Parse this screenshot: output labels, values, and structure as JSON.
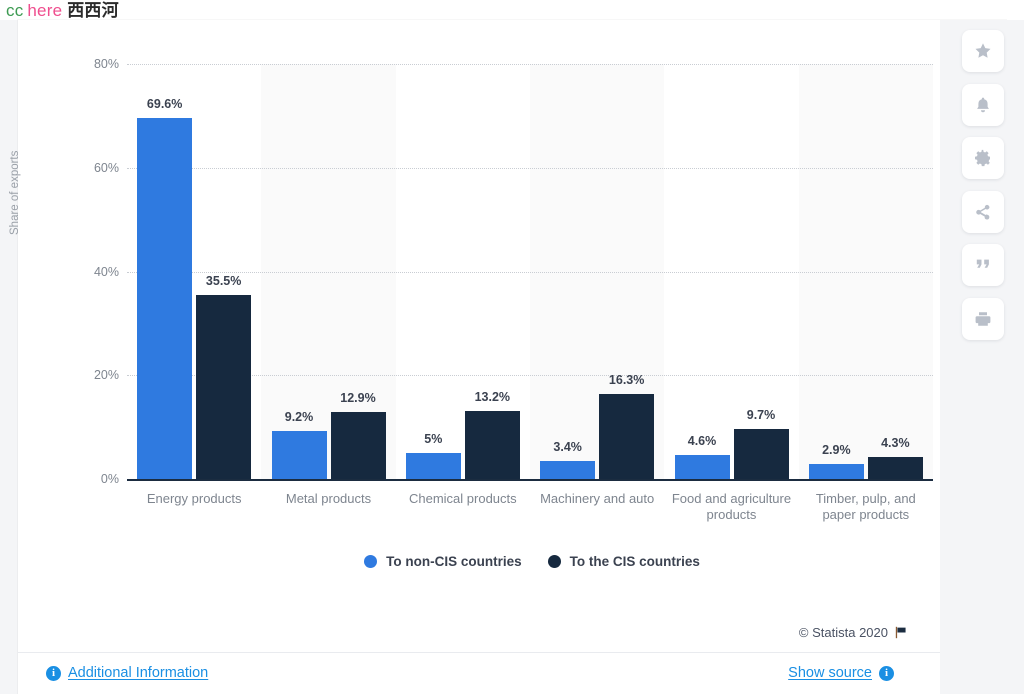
{
  "watermark": {
    "part1": "cc",
    "part2": "here",
    "part3": "西西河",
    "color1": "#3d9b52",
    "color2": "#ef4e8e",
    "color3": "#2b2b2b"
  },
  "chart_data": {
    "type": "bar",
    "title": "",
    "xlabel": "",
    "ylabel": "Share of exports",
    "ylim": [
      0,
      80
    ],
    "yticks": [
      "0%",
      "20%",
      "40%",
      "60%",
      "80%"
    ],
    "ytick_values": [
      0,
      20,
      40,
      60,
      80
    ],
    "grid": true,
    "legend_position": "bottom",
    "categories": [
      "Energy products",
      "Metal products",
      "Chemical products",
      "Machinery and auto",
      "Food and agriculture products",
      "Timber, pulp, and paper products"
    ],
    "series": [
      {
        "name": "To non-CIS countries",
        "color": "#2f7ae0",
        "values": [
          69.6,
          9.2,
          5,
          3.4,
          4.6,
          2.9
        ],
        "labels": [
          "69.6%",
          "9.2%",
          "5%",
          "3.4%",
          "4.6%",
          "2.9%"
        ]
      },
      {
        "name": "To the CIS countries",
        "color": "#16293f",
        "values": [
          35.5,
          12.9,
          13.2,
          16.3,
          9.7,
          4.3
        ],
        "labels": [
          "35.5%",
          "12.9%",
          "13.2%",
          "16.3%",
          "9.7%",
          "4.3%"
        ]
      }
    ]
  },
  "legend": [
    {
      "label": "To non-CIS countries",
      "color": "#2f7ae0"
    },
    {
      "label": "To the CIS countries",
      "color": "#16293f"
    }
  ],
  "copyright": {
    "text": "© Statista 2020",
    "flag_icon": "flag-icon"
  },
  "footer": {
    "additional_information": "Additional Information",
    "show_source": "Show source",
    "info_glyph": "i"
  },
  "rail": {
    "buttons": [
      {
        "name": "star-icon",
        "tooltip": "Favorite"
      },
      {
        "name": "bell-icon",
        "tooltip": "Notify"
      },
      {
        "name": "gear-icon",
        "tooltip": "Settings"
      },
      {
        "name": "share-icon",
        "tooltip": "Share"
      },
      {
        "name": "quote-icon",
        "tooltip": "Cite"
      },
      {
        "name": "print-icon",
        "tooltip": "Print"
      }
    ]
  },
  "colors": {
    "series_blue": "#2f7ae0",
    "series_navy": "#16293f",
    "band": "#fafafa",
    "grid": "#c9cdd3",
    "axis": "#1b2c40",
    "link": "#1a8fe3",
    "tick_text": "#7e858f",
    "label_text": "#3b4250"
  }
}
